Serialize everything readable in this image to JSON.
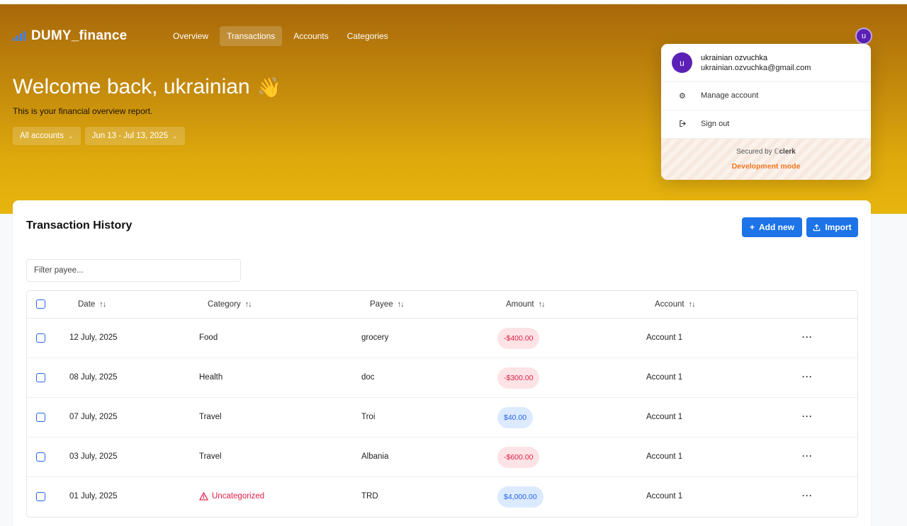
{
  "app": {
    "logo_text": "DUMY_finance",
    "nav": [
      {
        "label": "Overview"
      },
      {
        "label": "Transactions"
      },
      {
        "label": "Accounts"
      },
      {
        "label": "Categories"
      }
    ],
    "active_nav": "Transactions",
    "avatar_initial": "u"
  },
  "hero": {
    "welcome": "Welcome back, ukrainian",
    "welcome_emoji": "👋",
    "subtitle": "This is your financial overview report.",
    "account_filter": "All accounts",
    "date_filter": "Jun 13 - Jul 13, 2025"
  },
  "transactions": {
    "title": "Transaction History",
    "add_button": "Add new",
    "import_button": "Import",
    "filter_placeholder": "Filter payee...",
    "columns": [
      "Date",
      "Category",
      "Payee",
      "Amount",
      "Account"
    ],
    "rows": [
      {
        "date": "12 July, 2025",
        "category": "Food",
        "payee": "grocery",
        "amount": "-$400.00",
        "amount_type": "negative",
        "account": "Account 1"
      },
      {
        "date": "08 July, 2025",
        "category": "Health",
        "payee": "doc",
        "amount": "-$300.00",
        "amount_type": "negative",
        "account": "Account 1"
      },
      {
        "date": "07 July, 2025",
        "category": "Travel",
        "payee": "Troi",
        "amount": "$40.00",
        "amount_type": "positive",
        "account": "Account 1"
      },
      {
        "date": "03 July, 2025",
        "category": "Travel",
        "payee": "Albania",
        "amount": "-$600.00",
        "amount_type": "negative",
        "account": "Account 1"
      },
      {
        "date": "01 July, 2025",
        "category": "Uncategorized",
        "payee": "TRD",
        "amount": "$4,000.00",
        "amount_type": "positive",
        "account": "Account 1"
      }
    ]
  },
  "user_menu": {
    "avatar_initial": "u",
    "name": "ukrainian ozvuchka",
    "email": "ukrainian.ozvuchka@gmail.com",
    "manage_account": "Manage account",
    "sign_out": "Sign out",
    "secured_by": "Secured by",
    "provider": "clerk",
    "dev_mode": "Development mode"
  },
  "colors": {
    "accent": "#1d73e8",
    "brand_avatar": "#5b21b6",
    "negative": "#e11d48",
    "positive": "#2563eb",
    "dev_mode": "#f2761f"
  }
}
